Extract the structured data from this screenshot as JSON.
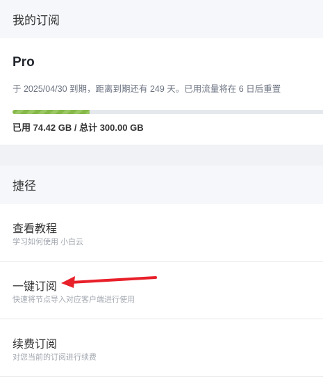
{
  "subscription": {
    "title": "我的订阅",
    "plan": "Pro",
    "description": "于 2025/04/30 到期，距离到期还有 249 天。已用流量将在 6 日后重置",
    "usage_text": "已用 74.42 GB / 总计 300.00 GB",
    "progress_percent": 24.8
  },
  "shortcuts": {
    "title": "捷径",
    "items": [
      {
        "label": "查看教程",
        "sub": "学习如何使用 小白云"
      },
      {
        "label": "一键订阅",
        "sub": "快速将节点导入对应客户端进行使用"
      },
      {
        "label": "续费订阅",
        "sub": "对您当前的订阅进行续费"
      }
    ]
  },
  "colors": {
    "progress": "#86b84a",
    "arrow": "#e8202a"
  }
}
